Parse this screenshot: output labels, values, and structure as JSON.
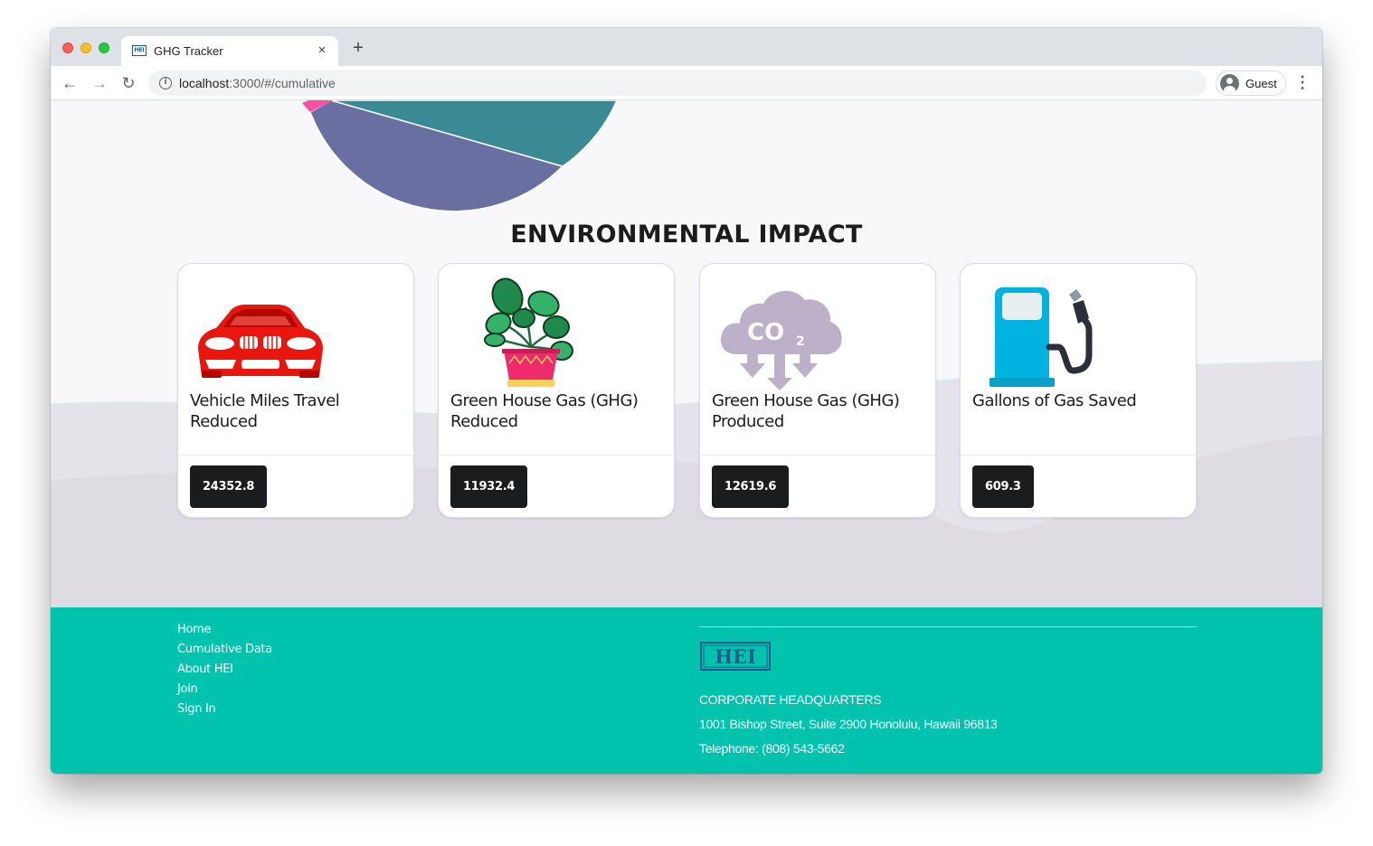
{
  "browser": {
    "tab_title": "GHG Tracker",
    "tab_favicon_text": "HEI",
    "tab_close_icon": "×",
    "new_tab_icon": "+",
    "url_host": "localhost",
    "url_path": ":3000/#/cumulative",
    "profile_label": "Guest",
    "back_icon": "←",
    "forward_icon": "→",
    "reload_icon": "↻",
    "menu_icon": "⋮",
    "info_icon": "i"
  },
  "page": {
    "section_title": "ENVIRONMENTAL IMPACT",
    "pie_colors": [
      "#6a6fa2",
      "#3a8a96",
      "#ff4fa3"
    ],
    "cards": [
      {
        "icon": "car-icon",
        "title": "Vehicle Miles Travel Reduced",
        "value": "24352.8"
      },
      {
        "icon": "plant-icon",
        "title": "Green House Gas (GHG) Reduced",
        "value": "11932.4"
      },
      {
        "icon": "co2-cloud-icon",
        "title": "Green House Gas (GHG) Produced",
        "value": "12619.6"
      },
      {
        "icon": "gas-pump-icon",
        "title": "Gallons of Gas Saved",
        "value": "609.3"
      }
    ]
  },
  "footer": {
    "links": [
      "Home",
      "Cumulative Data",
      "About HEI",
      "Join",
      "Sign In"
    ],
    "logo_text": "HEI",
    "hq_label": "CORPORATE HEADQUARTERS",
    "address": "1001 Bishop Street, Suite 2900 Honolulu, Hawaii 96813",
    "phone": "Telephone: (808) 543-5662",
    "background_color": "#00c3ae"
  }
}
